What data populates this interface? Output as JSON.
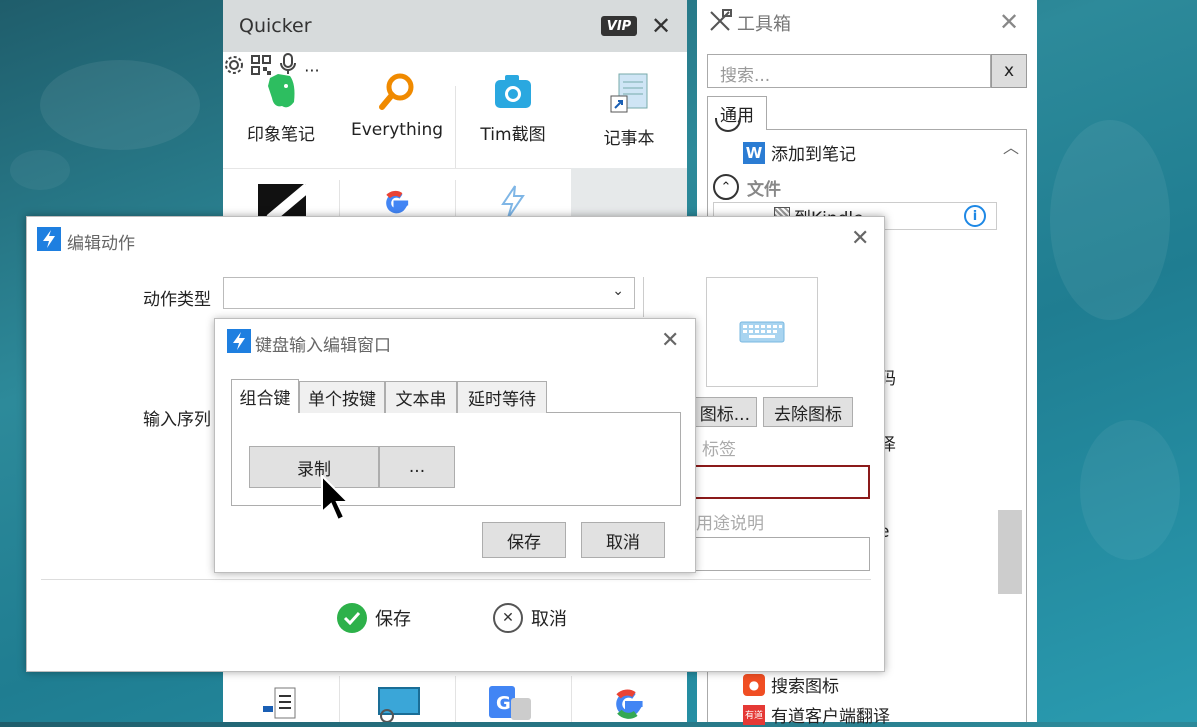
{
  "quicker": {
    "title": "Quicker",
    "vip_label": "VIP",
    "more_label": "···",
    "apps_row1": [
      {
        "label": "印象笔记",
        "icon": "evernote-icon"
      },
      {
        "label": "Everything",
        "icon": "everything-search-icon"
      },
      {
        "label": "Tim截图",
        "icon": "camera-icon"
      },
      {
        "label": "记事本",
        "icon": "notepad-icon"
      }
    ],
    "apps_row2_icons": [
      "black-app-icon",
      "google-icon",
      "quicker-bolt-icon",
      "blank-icon"
    ],
    "apps_bottom_icons": [
      "flowchart-icon",
      "monitor-icon",
      "google-translate-icon",
      "google-icon"
    ]
  },
  "toolbox": {
    "title": "工具箱",
    "search_placeholder": "搜索...",
    "clear_label": "x",
    "tab_label": "通用",
    "items": {
      "add_to_note": "添加到笔记",
      "file_group": "文件",
      "to_kindle": "到Kindle",
      "partial_code": "码",
      "partial_translate": "泽",
      "partial_e": "e",
      "search_icon": "搜索图标",
      "youdao": "有道客户端翻译",
      "youdao_badge": "有道"
    }
  },
  "edit_dialog": {
    "title": "编辑动作",
    "action_type_label": "动作类型",
    "action_type_value": "",
    "input_sequence_label": "输入序列",
    "icon_button_label": "图标...",
    "remove_icon_label": "去除图标",
    "tag_label": "标签",
    "usage_label": "用途说明",
    "save_label": "保存",
    "cancel_label": "取消"
  },
  "keyboard_dialog": {
    "title": "键盘输入编辑窗口",
    "tabs": [
      "组合键",
      "单个按键",
      "文本串",
      "延时等待"
    ],
    "record_label": "录制",
    "more_label": "...",
    "save_label": "保存",
    "cancel_label": "取消"
  },
  "colors": {
    "quicker_blue": "#1e7fe0",
    "save_green": "#2db14a",
    "error_border": "#8b1a1a",
    "info_blue": "#1e88e5"
  }
}
